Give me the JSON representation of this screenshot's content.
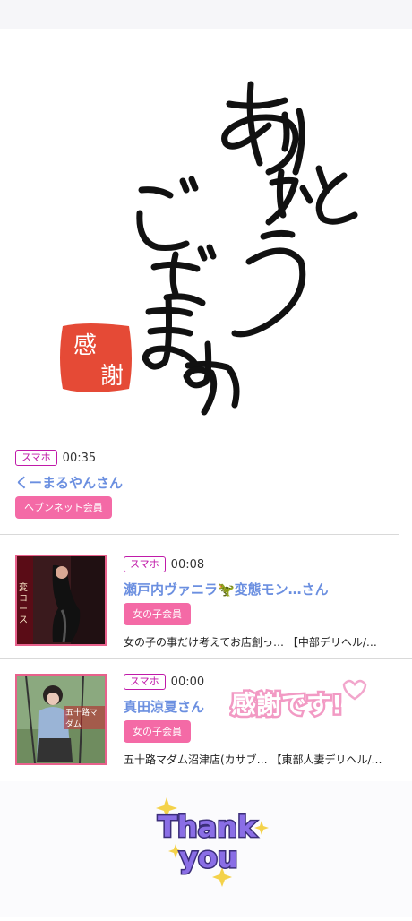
{
  "hero": {
    "calligraphy_text": "ありがとうございます",
    "stamp_text": "感謝"
  },
  "feed": [
    {
      "device": "スマホ",
      "time": "00:35",
      "name": "くーまるやんさん",
      "tag": "ヘブンネット会員"
    },
    {
      "device": "スマホ",
      "time": "00:08",
      "name": "瀬戸内ヴァニラ🦖変態モン…さん",
      "tag": "女の子会員",
      "desc": "女の子の事だけ考えてお店創っ…  【中部デリヘル/…",
      "thumb_text": "変コース"
    },
    {
      "device": "スマホ",
      "time": "00:00",
      "name": "真田涼夏さん",
      "tag": "女の子会員",
      "desc": "五十路マダム沼津店(カサブ…  【東部人妻デリヘル/…",
      "thumb_text": "五十路マダム"
    }
  ],
  "sticker_text": "感謝です!",
  "footer_text": "Thank you",
  "colors": {
    "accent_pink": "#f46aa6",
    "badge_magenta": "#c01aa9",
    "name_blue": "#6b8fe0",
    "stamp_red": "#e54a36"
  }
}
